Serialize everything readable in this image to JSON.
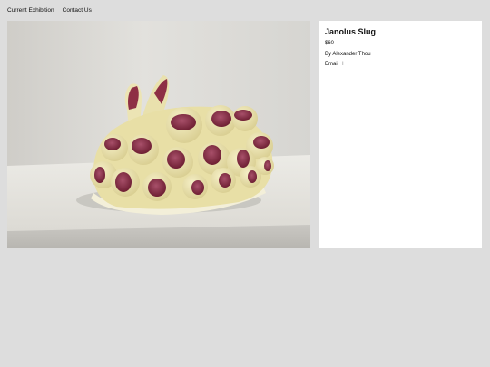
{
  "nav": {
    "items": [
      {
        "label": "Current Exhibition"
      },
      {
        "label": "Contact Us"
      }
    ]
  },
  "artwork": {
    "title": "Janolus Slug",
    "price": "$60",
    "artist": "By Alexander Thou",
    "email_label": "Email",
    "email_marker": "I"
  },
  "colors": {
    "page_bg": "#dddddd",
    "panel_bg": "#ffffff",
    "ceramic_cream": "#ece4b4",
    "spot_maroon": "#8e2f45"
  }
}
